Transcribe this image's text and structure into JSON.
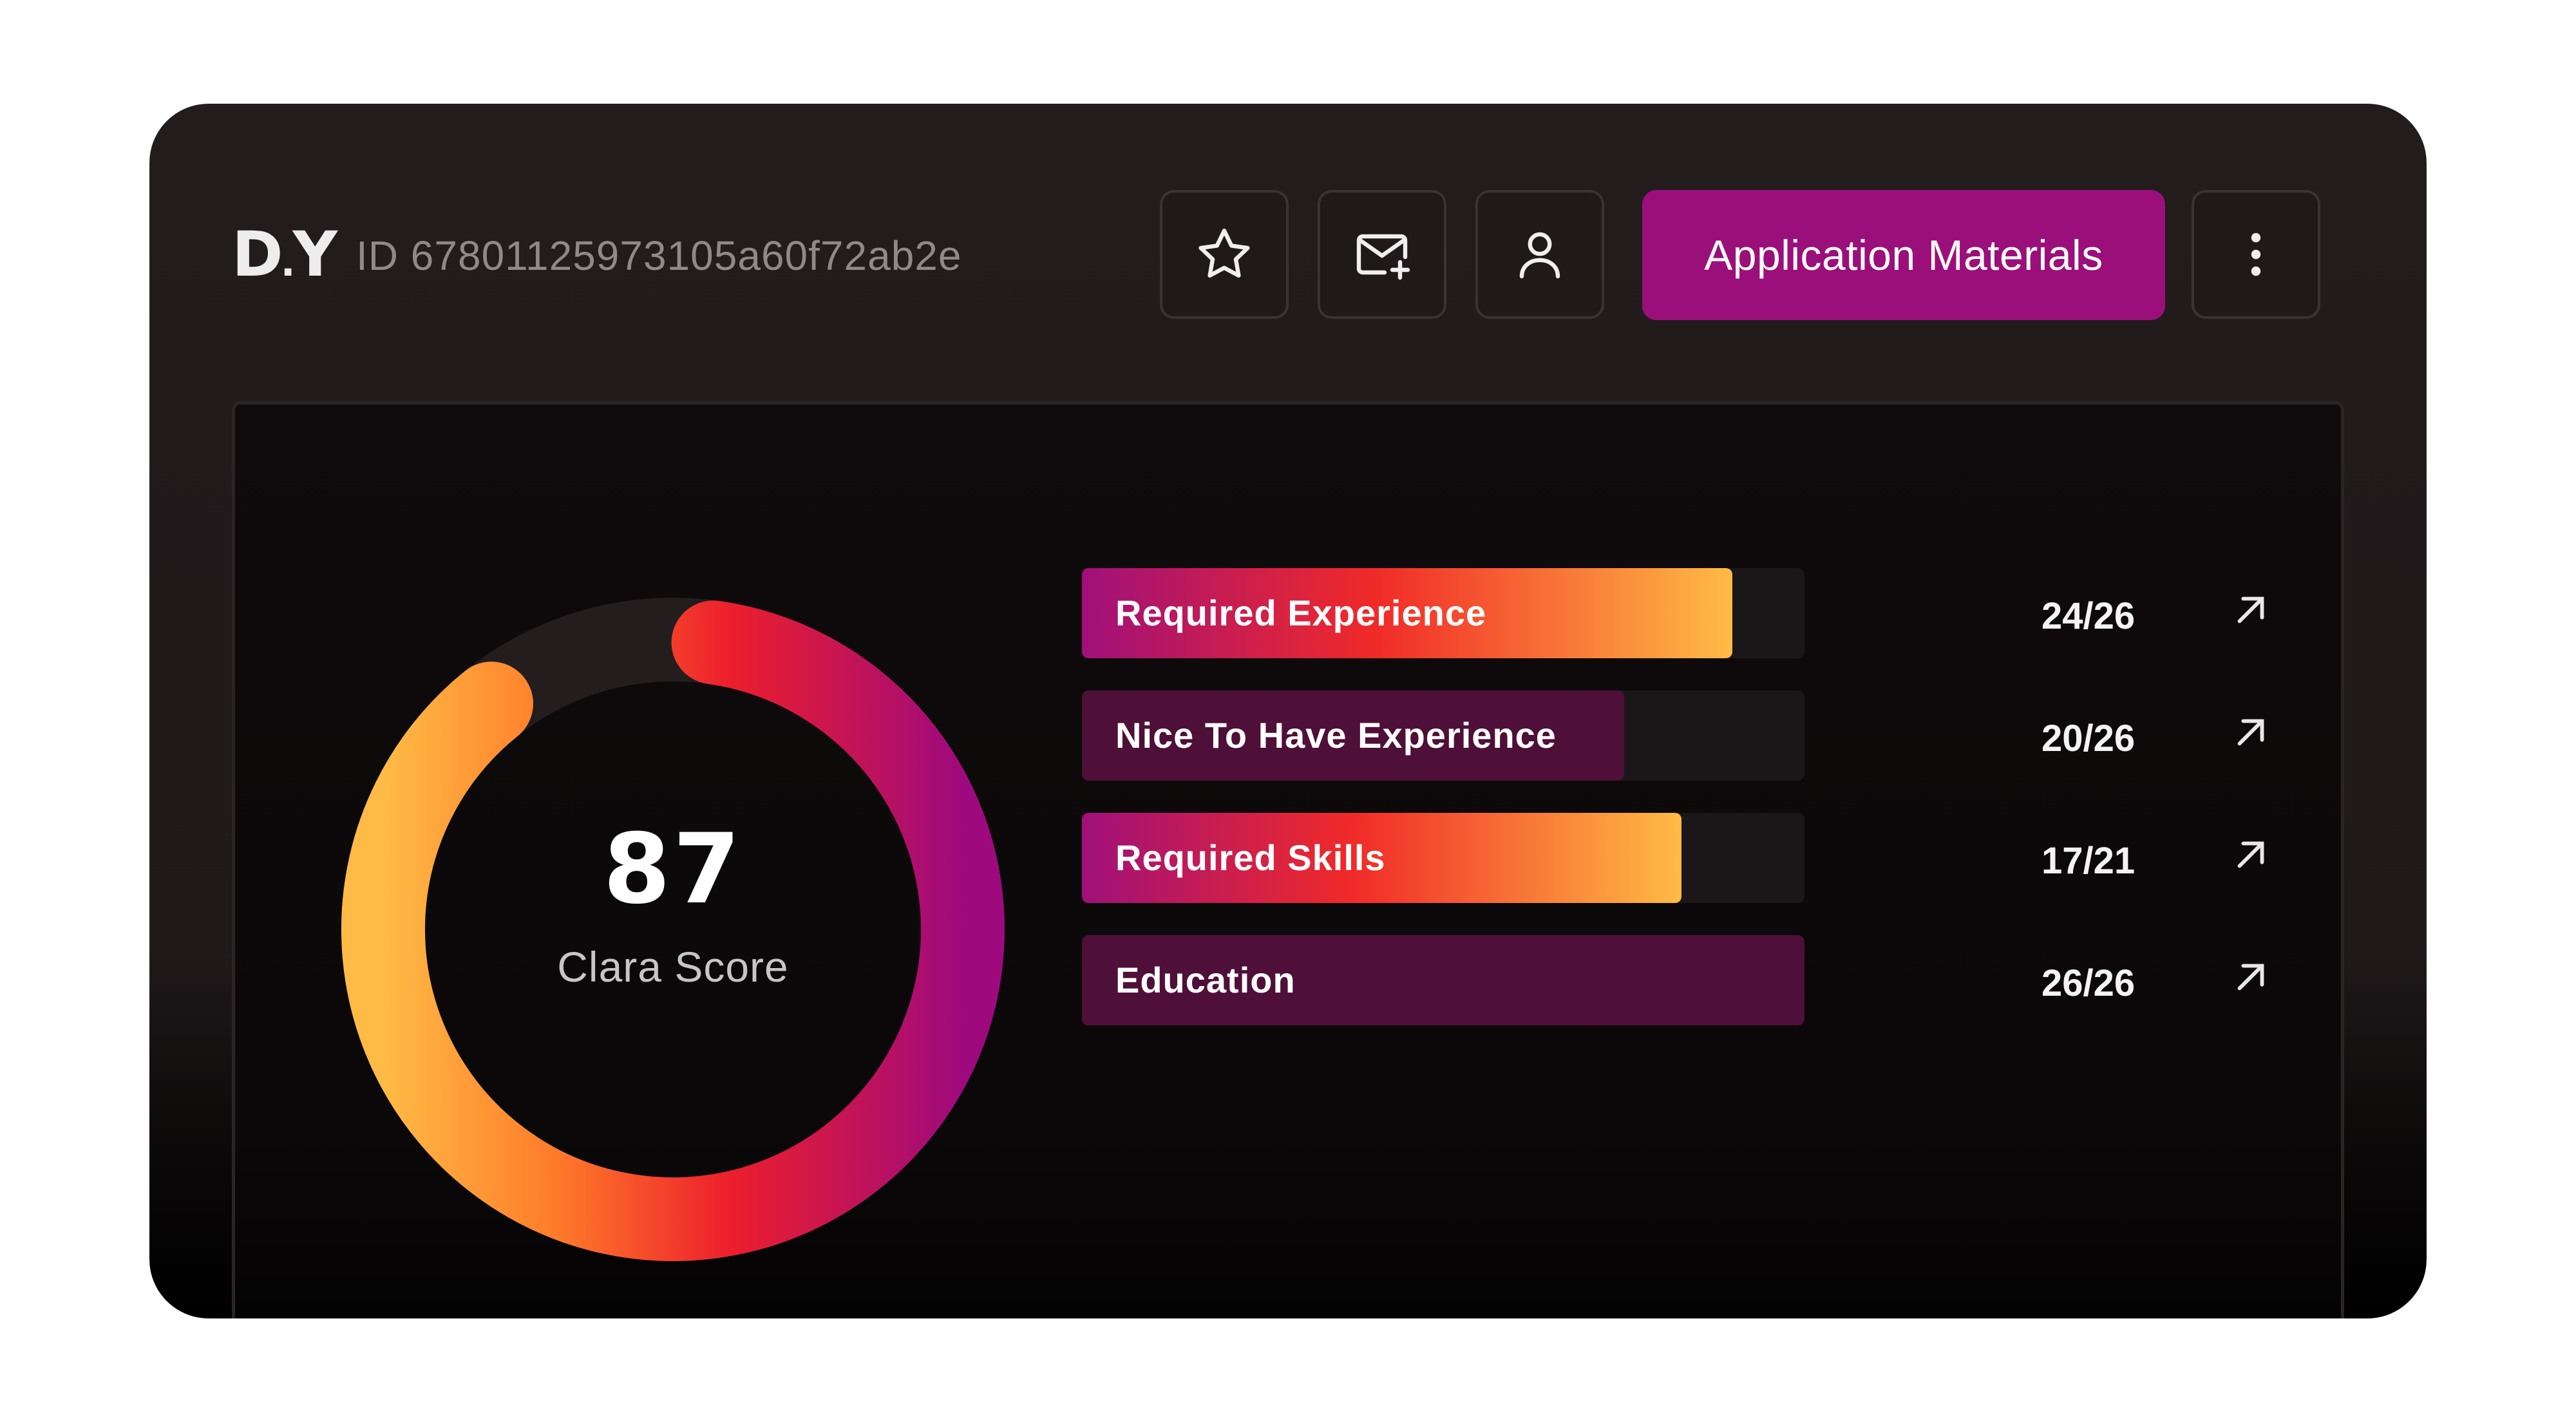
{
  "header": {
    "logo_left": "D",
    "logo_dot": ".",
    "logo_right": "Y",
    "candidate_id": "ID 67801125973105a60f72ab2e",
    "actions": [
      {
        "icon": "star-icon"
      },
      {
        "icon": "mail-plus-icon"
      },
      {
        "icon": "user-icon"
      }
    ],
    "application_materials_label": "Application Materials",
    "more_icon": "more-vertical-icon"
  },
  "score": {
    "value": "87",
    "label": "Clara Score",
    "fraction": 0.87
  },
  "metrics": [
    {
      "label": "Required Experience",
      "score": "24/26",
      "fill": 0.9,
      "style": "gradient"
    },
    {
      "label": "Nice To Have Experience",
      "score": "20/26",
      "fill": 0.75,
      "style": "muted"
    },
    {
      "label": "Required Skills",
      "score": "17/21",
      "fill": 0.83,
      "style": "gradient"
    },
    {
      "label": "Education",
      "score": "26/26",
      "fill": 1.0,
      "style": "muted"
    }
  ],
  "colors": {
    "accent": "#9b0f7b",
    "gradient_start": "#a0107a",
    "gradient_mid": "#f02a28",
    "gradient_end": "#ffbb45",
    "muted_fill": "#4e0f38"
  }
}
